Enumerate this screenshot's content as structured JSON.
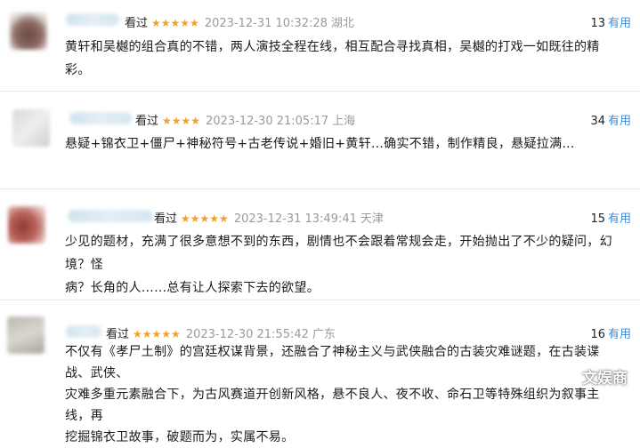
{
  "reviews": [
    {
      "seen": "看过",
      "stars": "★★★★★",
      "date": "2023-12-31 10:32:28",
      "location": "湖北",
      "useful_count": "13",
      "useful_label": "有用",
      "text": "黄轩和吴樾的组合真的不错，两人演技全程在线，相互配合寻找真相，吴樾的打戏一如既往的精彩。",
      "avatar_color": "#8a6a63"
    },
    {
      "seen": "看过",
      "stars": "★★★★",
      "date": "2023-12-30 21:05:17",
      "location": "上海",
      "useful_count": "34",
      "useful_label": "有用",
      "text": "悬疑+锦衣卫+僵尸+神秘符号+古老传说+婚旧+黄轩…确实不错，制作精良，悬疑拉满…",
      "avatar_color": "#d7d7d7"
    },
    {
      "seen": "看过",
      "stars": "★★★★★",
      "date": "2023-12-31 13:49:41",
      "location": "天津",
      "useful_count": "15",
      "useful_label": "有用",
      "text_lines": [
        "少见的题材，充满了很多意想不到的东西，剧情也不会跟着常规会走，开始抛出了不少的疑问，幻境？怪",
        "病？长角的人……总有让人探索下去的欲望。"
      ],
      "avatar_color": "#b9625a"
    },
    {
      "seen": "看过",
      "stars": "★★★★★",
      "date": "2023-12-30 21:55:42",
      "location": "广东",
      "useful_count": "16",
      "useful_label": "有用",
      "text_lines": [
        "不仅有《孝尸土制》的宫廷权谋背景，还融合了神秘主义与武侠融合的古装灾难谜题，在古装谍战、武侠、",
        "灾难多重元素融合下，为古风赛道开创新风格，悬不良人、夜不收、命石卫等特殊组织为叙事主线，再",
        "挖掘锦衣卫故事，破题而为，实属不易。"
      ],
      "avatar_color": "#c9c6c0"
    }
  ],
  "watermark": "文娱商"
}
